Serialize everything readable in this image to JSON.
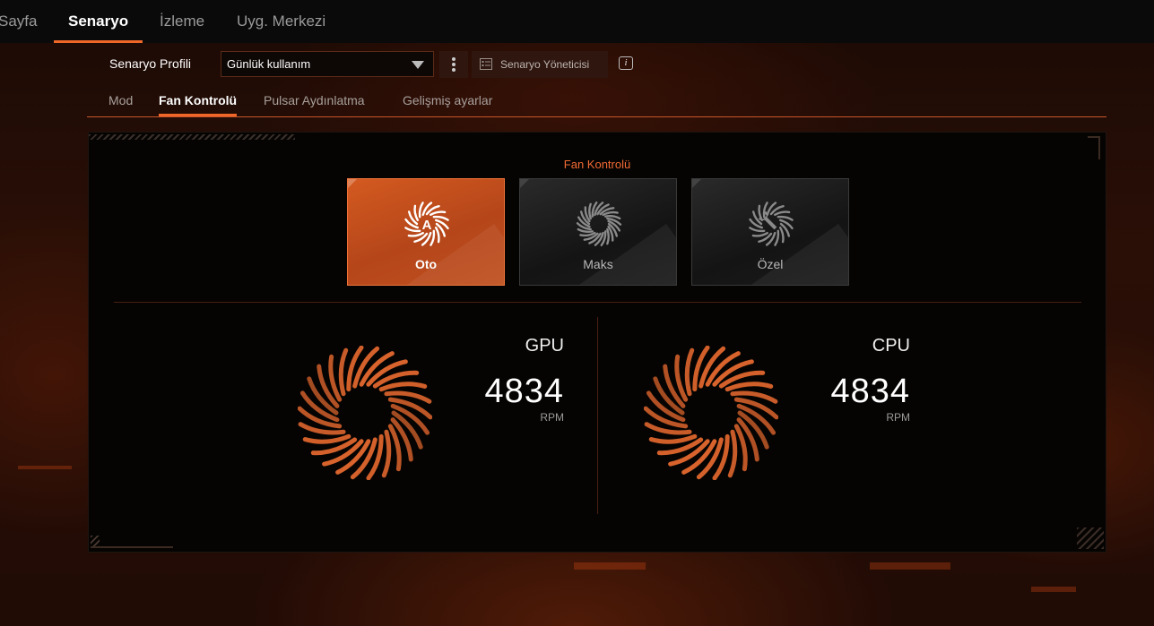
{
  "nav": {
    "tabs": [
      {
        "label": "Sayfa"
      },
      {
        "label": "Senaryo"
      },
      {
        "label": "İzleme"
      },
      {
        "label": "Uyg. Merkezi"
      }
    ],
    "active_index": 1
  },
  "profile": {
    "label": "Senaryo Profili",
    "selected": "Günlük kullanım",
    "manager_label": "Senaryo Yöneticisi"
  },
  "subtabs": {
    "items": [
      {
        "label": "Mod"
      },
      {
        "label": "Fan Kontrolü"
      },
      {
        "label": "Pulsar Aydınlatma"
      },
      {
        "label": "Gelişmiş ayarlar"
      }
    ],
    "active_index": 1
  },
  "fan_control": {
    "title": "Fan Kontrolü",
    "modes": [
      {
        "label": "Oto",
        "icon": "fan-auto-icon",
        "active": true
      },
      {
        "label": "Maks",
        "icon": "fan-max-icon",
        "active": false
      },
      {
        "label": "Özel",
        "icon": "fan-custom-icon",
        "active": false
      }
    ]
  },
  "gauges": {
    "gpu": {
      "name": "GPU",
      "value": "4834",
      "unit": "RPM"
    },
    "cpu": {
      "name": "CPU",
      "value": "4834",
      "unit": "RPM"
    }
  },
  "colors": {
    "accent": "#f0672a",
    "active_card": "#c9521e"
  }
}
